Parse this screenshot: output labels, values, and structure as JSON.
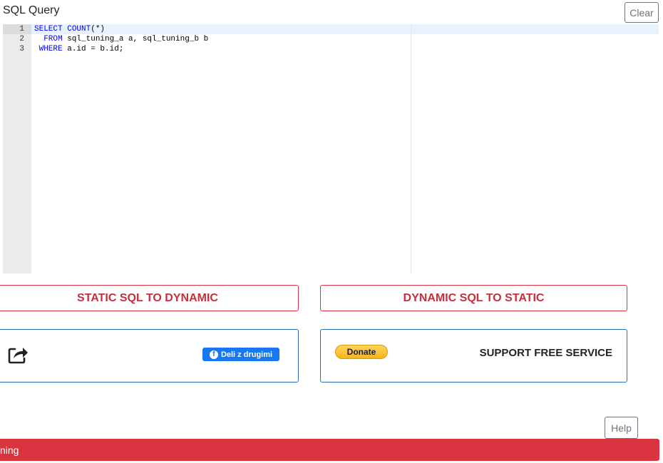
{
  "header": {
    "title": "SQL Query",
    "clear_label": "Clear"
  },
  "editor": {
    "line_numbers": [
      "1",
      "2",
      "3"
    ],
    "lines": [
      {
        "kw": "SELECT",
        "space": " ",
        "fn": "COUNT",
        "rest": "(*)"
      },
      {
        "indent": "  ",
        "kw": "FROM",
        "rest": " sql_tuning_a a, sql_tuning_b b"
      },
      {
        "indent": " ",
        "kw": "WHERE",
        "rest": " a.id = b.id;"
      }
    ]
  },
  "actions": {
    "static_to_dynamic": "STATIC SQL TO DYNAMIC",
    "dynamic_to_static": "DYNAMIC SQL TO STATIC"
  },
  "share": {
    "icon": "share-icon",
    "facebook_label": "Deli z drugimi",
    "facebook_icon": "facebook-icon"
  },
  "support": {
    "donate_label": "Donate",
    "text": "SUPPORT FREE SERVICE"
  },
  "help_label": "Help",
  "status_bar": {
    "text": "ning",
    "color": "#d9343f"
  },
  "colors": {
    "accent_red": "#dc3545",
    "accent_blue": "#2a6fb0",
    "facebook_blue": "#1877f2"
  }
}
